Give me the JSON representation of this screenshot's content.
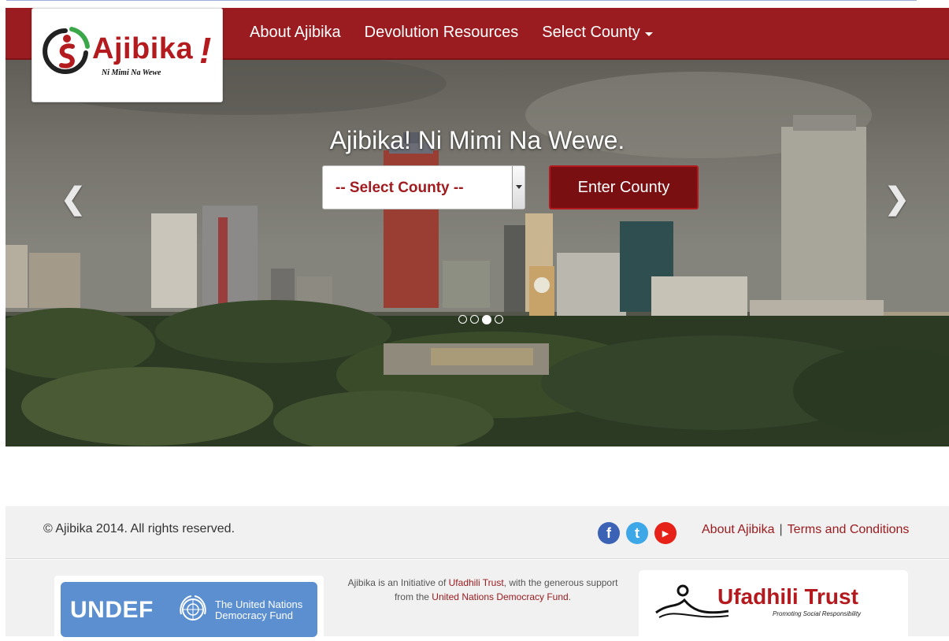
{
  "brand": {
    "name": "Ajibika",
    "exclaim": "!",
    "tagline": "Ni Mimi Na Wewe",
    "primary_color": "#9a1c20",
    "accent_color": "#b3191d"
  },
  "nav": {
    "items": [
      {
        "label": "About Ajibika"
      },
      {
        "label": "Devolution Resources"
      },
      {
        "label": "Select County",
        "icon": "caret-down-icon"
      }
    ]
  },
  "hero": {
    "title": "Ajibika! Ni Mimi Na Wewe.",
    "select": {
      "value": "-- Select County --"
    },
    "enter_button": "Enter County",
    "prev_icon": "chevron-left-icon",
    "next_icon": "chevron-right-icon",
    "slides": {
      "count": 4,
      "active_index": 2
    }
  },
  "footer": {
    "copyright": "© Ajibika 2014. All rights reserved.",
    "social": [
      {
        "name": "facebook-icon",
        "glyph": "f",
        "color": "#3b62b5"
      },
      {
        "name": "twitter-icon",
        "glyph": "t",
        "color": "#3ea7e7"
      },
      {
        "name": "youtube-icon",
        "glyph": "▶",
        "color": "#e62117"
      }
    ],
    "links": {
      "about": "About Ajibika",
      "separator": "|",
      "terms": "Terms and Conditions"
    },
    "undef": {
      "acronym": "UNDEF",
      "line1": "The United Nations",
      "line2": "Democracy Fund"
    },
    "initiative": {
      "prefix": "Ajibika is an Initiative of",
      "trust": "Ufadhili Trust",
      "middle": ", with the generous support from the",
      "fund": "United Nations Democracy Fund",
      "suffix": "."
    },
    "ufadhili": {
      "name": "Ufadhili Trust",
      "tagline": "Promoting Social Responsibility"
    }
  }
}
